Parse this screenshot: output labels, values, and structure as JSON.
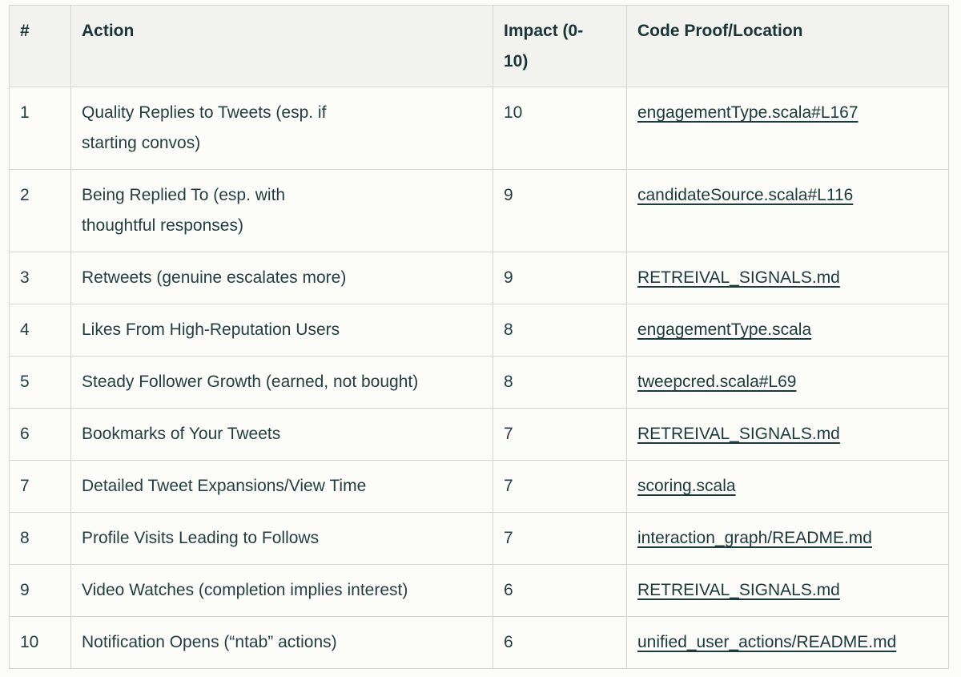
{
  "table": {
    "headers": [
      "#",
      "Action",
      "Impact (0-\n10)",
      "Code Proof/Location"
    ],
    "header_num": "#",
    "header_action": "Action",
    "header_impact": "Impact (0-",
    "header_impact_line2": "10)",
    "header_code": "Code Proof/Location",
    "rows": [
      {
        "num": "1",
        "action": "Quality Replies to Tweets (esp. if",
        "action_line2": "starting convos)",
        "impact": "10",
        "code": "engagementType.scala#L167",
        "tall": true
      },
      {
        "num": "2",
        "action": "Being Replied To (esp. with",
        "action_line2": "thoughtful responses)",
        "impact": "9",
        "code": "candidateSource.scala#L116",
        "tall": true
      },
      {
        "num": "3",
        "action": "Retweets (genuine escalates more)",
        "action_line2": "",
        "impact": "9",
        "code": "RETREIVAL_SIGNALS.md",
        "tall": false
      },
      {
        "num": "4",
        "action": "Likes From High-Reputation Users",
        "action_line2": "",
        "impact": "8",
        "code": "engagementType.scala",
        "tall": false
      },
      {
        "num": "5",
        "action": "Steady Follower Growth (earned, not bought)",
        "action_line2": "",
        "impact": "8",
        "code": "tweepcred.scala#L69",
        "tall": false
      },
      {
        "num": "6",
        "action": "Bookmarks of Your Tweets",
        "action_line2": "",
        "impact": "7",
        "code": "RETREIVAL_SIGNALS.md",
        "tall": false
      },
      {
        "num": "7",
        "action": "Detailed Tweet Expansions/View Time",
        "action_line2": "",
        "impact": "7",
        "code": "scoring.scala",
        "tall": false
      },
      {
        "num": "8",
        "action": "Profile Visits Leading to Follows",
        "action_line2": "",
        "impact": "7",
        "code": "interaction_graph/README.md",
        "tall": false
      },
      {
        "num": "9",
        "action": "Video Watches (completion implies interest)",
        "action_line2": "",
        "impact": "6",
        "code": "RETREIVAL_SIGNALS.md",
        "tall": false
      },
      {
        "num": "10",
        "action": "Notification Opens (“ntab” actions)",
        "action_line2": "",
        "impact": "6",
        "code": "unified_user_actions/README.md",
        "tall": false
      }
    ]
  },
  "colors": {
    "text": "#1c3b3d",
    "header_bg": "#f2f3ef",
    "border": "#d3d6d3",
    "page_bg": "#fcfcf9"
  }
}
